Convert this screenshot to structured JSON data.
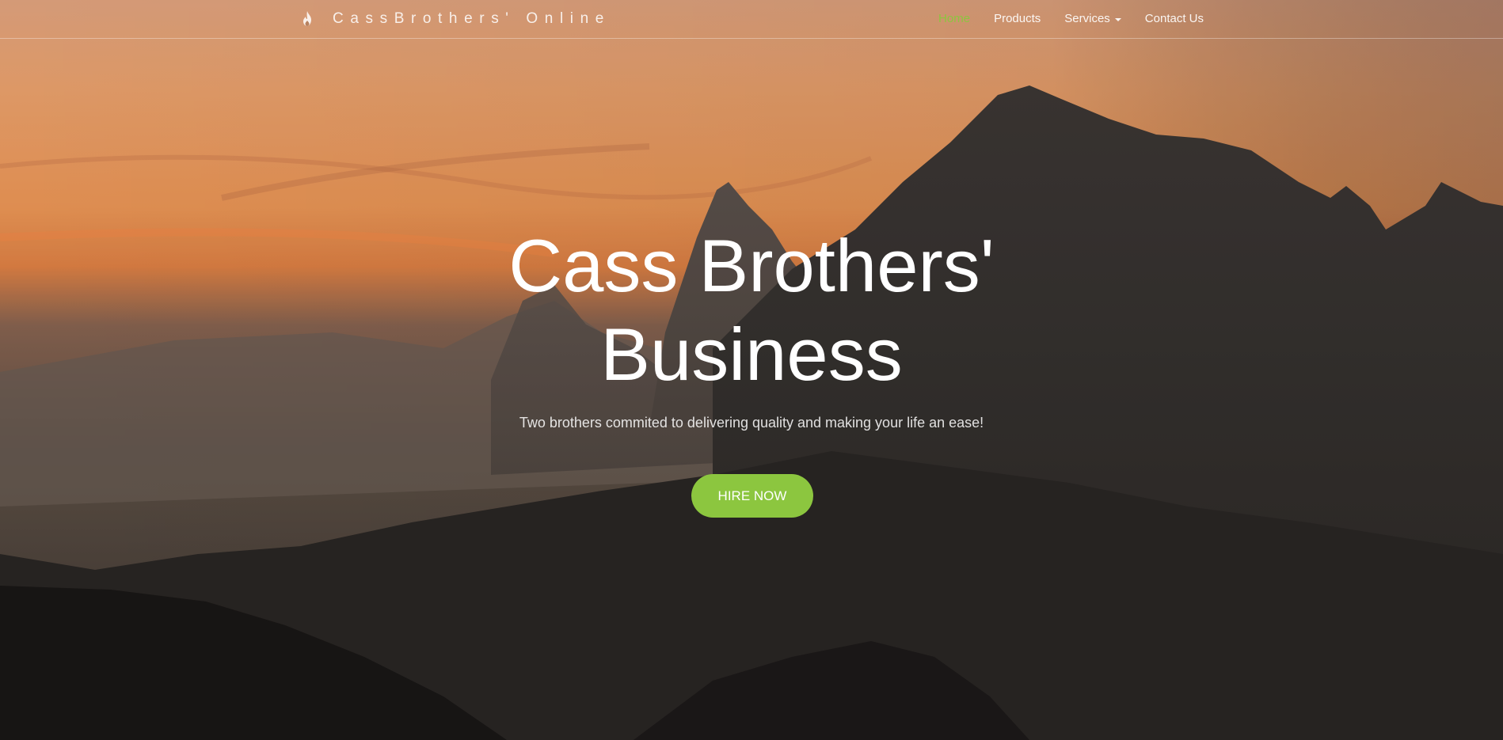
{
  "navbar": {
    "brand_icon": "fire-icon",
    "brand_text": "CassBrothers' Online",
    "links": [
      {
        "label": "Home",
        "active": true
      },
      {
        "label": "Products",
        "active": false
      },
      {
        "label": "Services",
        "active": false,
        "dropdown": true
      },
      {
        "label": "Contact Us",
        "active": false
      }
    ]
  },
  "hero": {
    "title_line1": "Cass Brothers'",
    "title_line2": "Business",
    "subtitle": "Two brothers commited to delivering quality and making your life an ease!",
    "cta_label": "HIRE NOW"
  },
  "colors": {
    "accent": "#8cc63f",
    "sky_top": "#e9a27a",
    "sky_glow": "#f2863f",
    "mountain_dark": "#1c1a19"
  }
}
